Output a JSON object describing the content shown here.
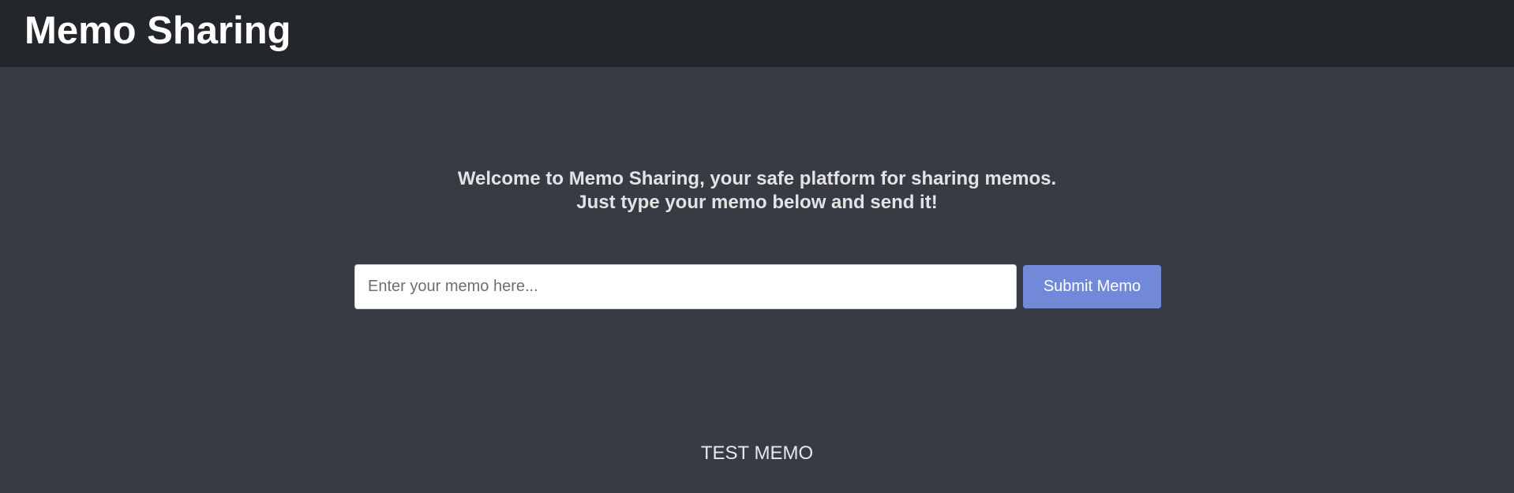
{
  "header": {
    "title": "Memo Sharing"
  },
  "welcome": {
    "line1": "Welcome to Memo Sharing, your safe platform for sharing memos.",
    "line2": "Just type your memo below and send it!"
  },
  "form": {
    "input_value": "",
    "input_placeholder": "Enter your memo here...",
    "submit_label": "Submit Memo"
  },
  "memos": [
    {
      "text": "TEST MEMO"
    }
  ],
  "colors": {
    "header_bg": "#23272b",
    "page_bg": "#383b44",
    "accent": "#7289da"
  }
}
